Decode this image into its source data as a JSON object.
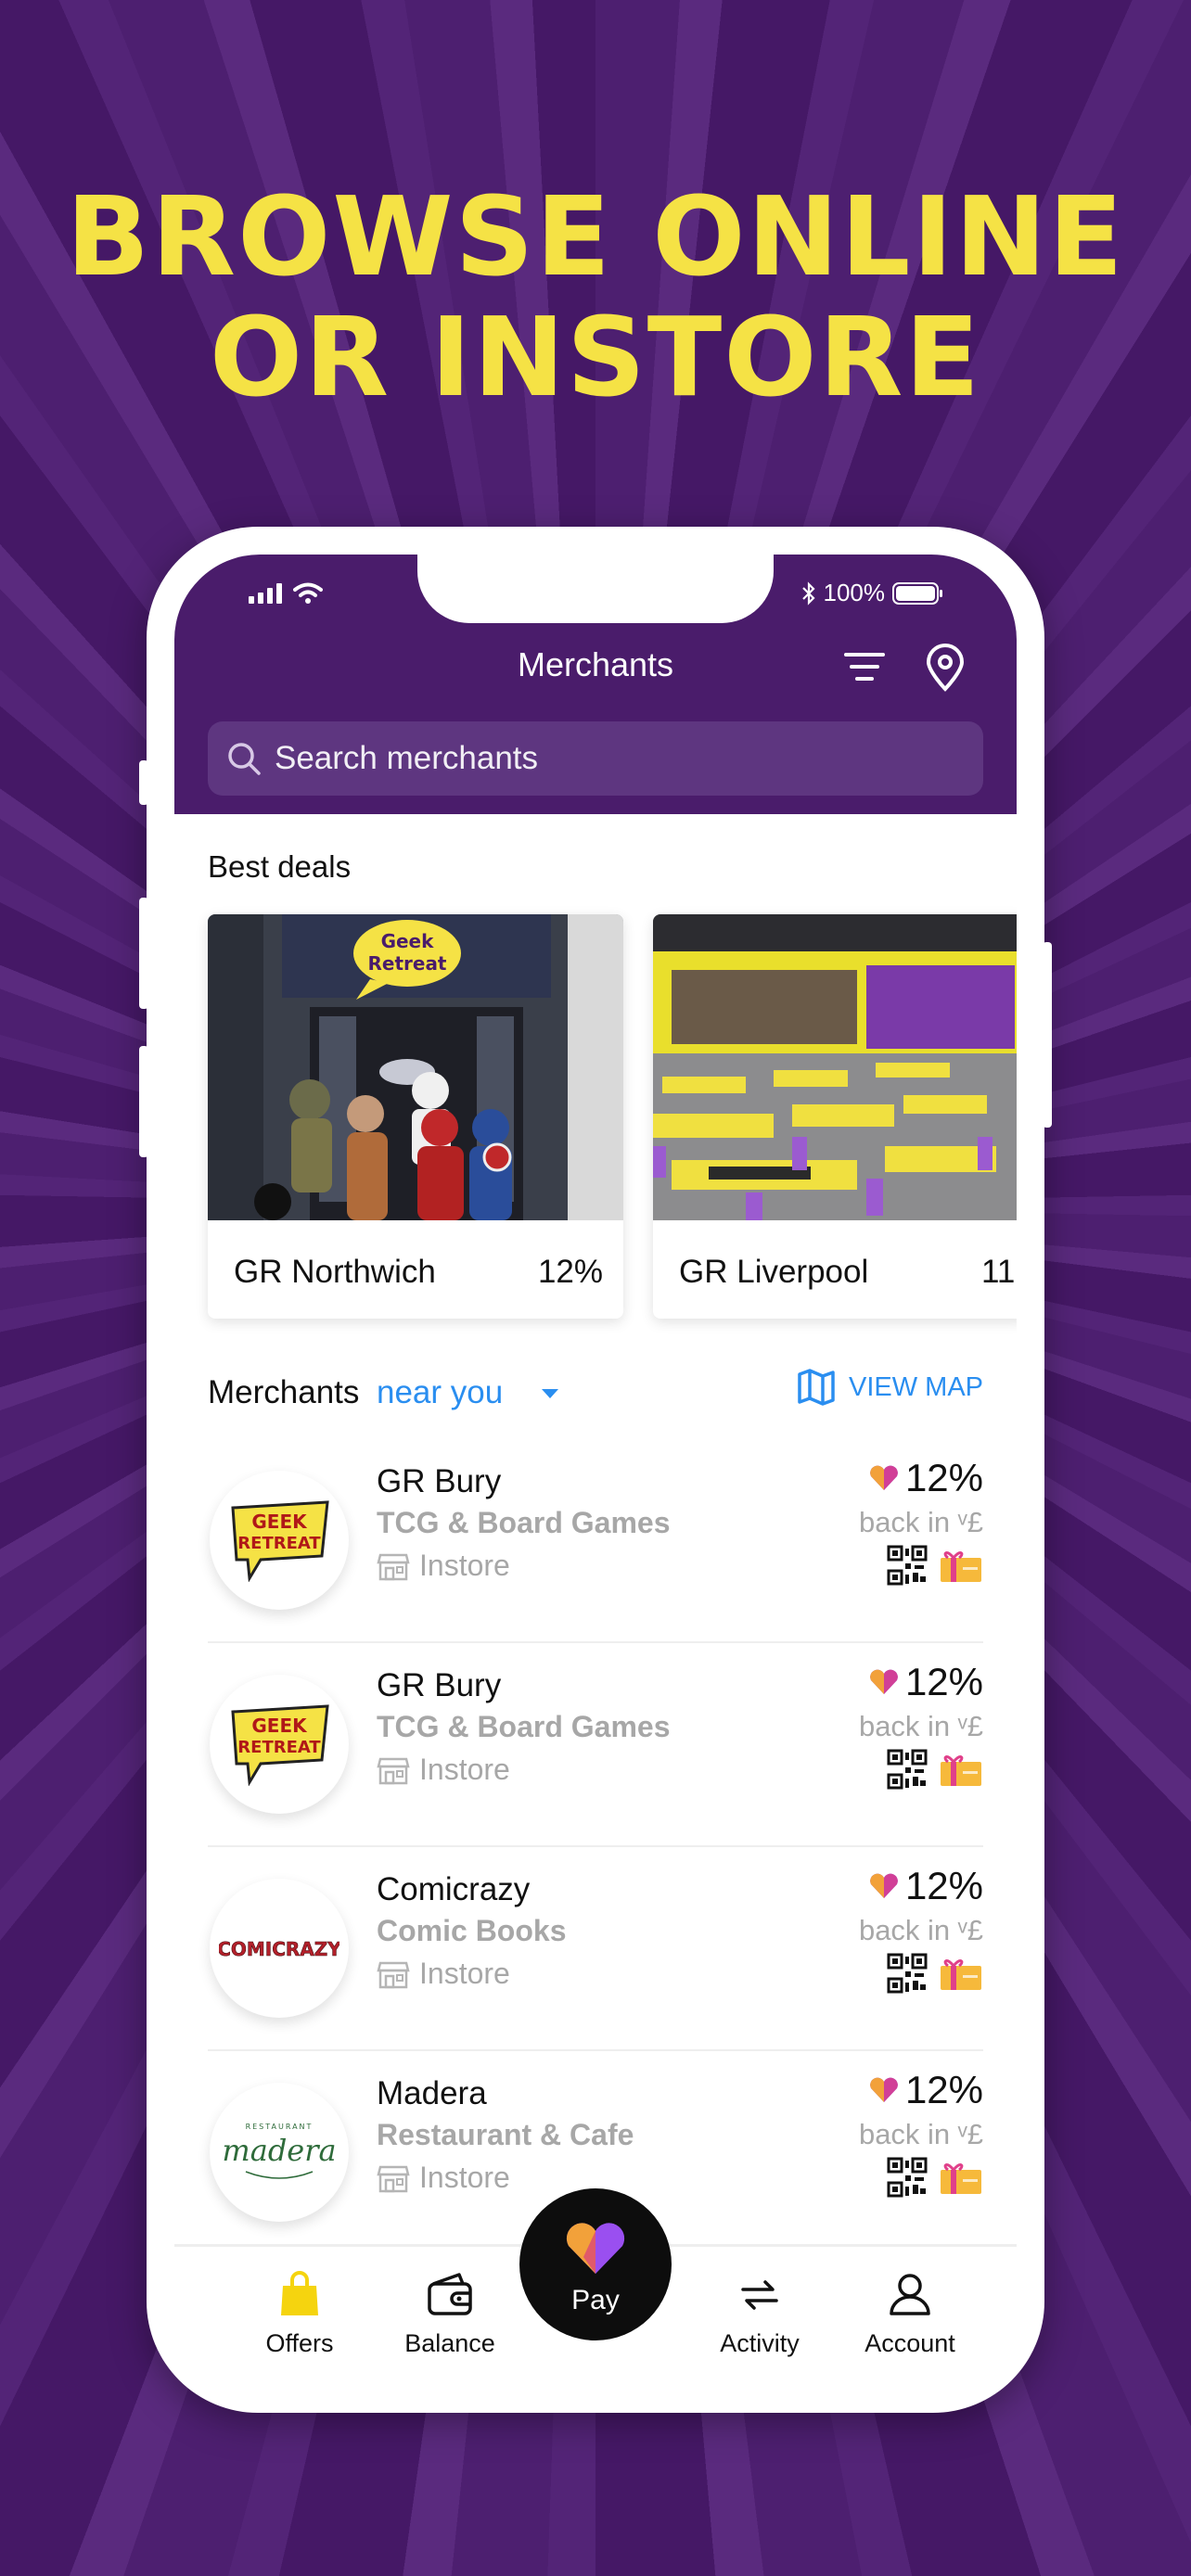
{
  "headline": {
    "line1": "BROWSE ONLINE",
    "line2": "OR INSTORE"
  },
  "status_bar": {
    "battery": "100%"
  },
  "header": {
    "title": "Merchants",
    "search_placeholder": "Search merchants"
  },
  "best_deals": {
    "title": "Best deals",
    "cards": [
      {
        "name": "GR Northwich",
        "percent": "12%",
        "sign_text_1": "Geek",
        "sign_text_2": "Retreat"
      },
      {
        "name": "GR Liverpool",
        "percent": "11"
      }
    ]
  },
  "nearby": {
    "label": "Merchants",
    "link": "near you",
    "view_map": "VIEW MAP"
  },
  "merchants": [
    {
      "name": "GR Bury",
      "category": "TCG & Board Games",
      "mode": "Instore",
      "percent": "12%",
      "back": "back in ᵛ£",
      "logo_line1": "GEEK",
      "logo_line2": "RETREAT"
    },
    {
      "name": "GR Bury",
      "category": "TCG & Board Games",
      "mode": "Instore",
      "percent": "12%",
      "back": "back in ᵛ£",
      "logo_line1": "GEEK",
      "logo_line2": "RETREAT"
    },
    {
      "name": "Comicrazy",
      "category": "Comic Books",
      "mode": "Instore",
      "percent": "12%",
      "back": "back in ᵛ£",
      "logo_text": "COMICRAZY"
    },
    {
      "name": "Madera",
      "category": "Restaurant & Cafe",
      "mode": "Instore",
      "percent": "12%",
      "back": "back in ᵛ£",
      "logo_text": "madera",
      "logo_top": "RESTAURANT"
    }
  ],
  "tabbar": {
    "offers": "Offers",
    "balance": "Balance",
    "pay": "Pay",
    "activity": "Activity",
    "account": "Account"
  },
  "colors": {
    "brand_purple": "#4a1c6b",
    "headline_yellow": "#f5e245",
    "link_blue": "#2a8ef0"
  }
}
